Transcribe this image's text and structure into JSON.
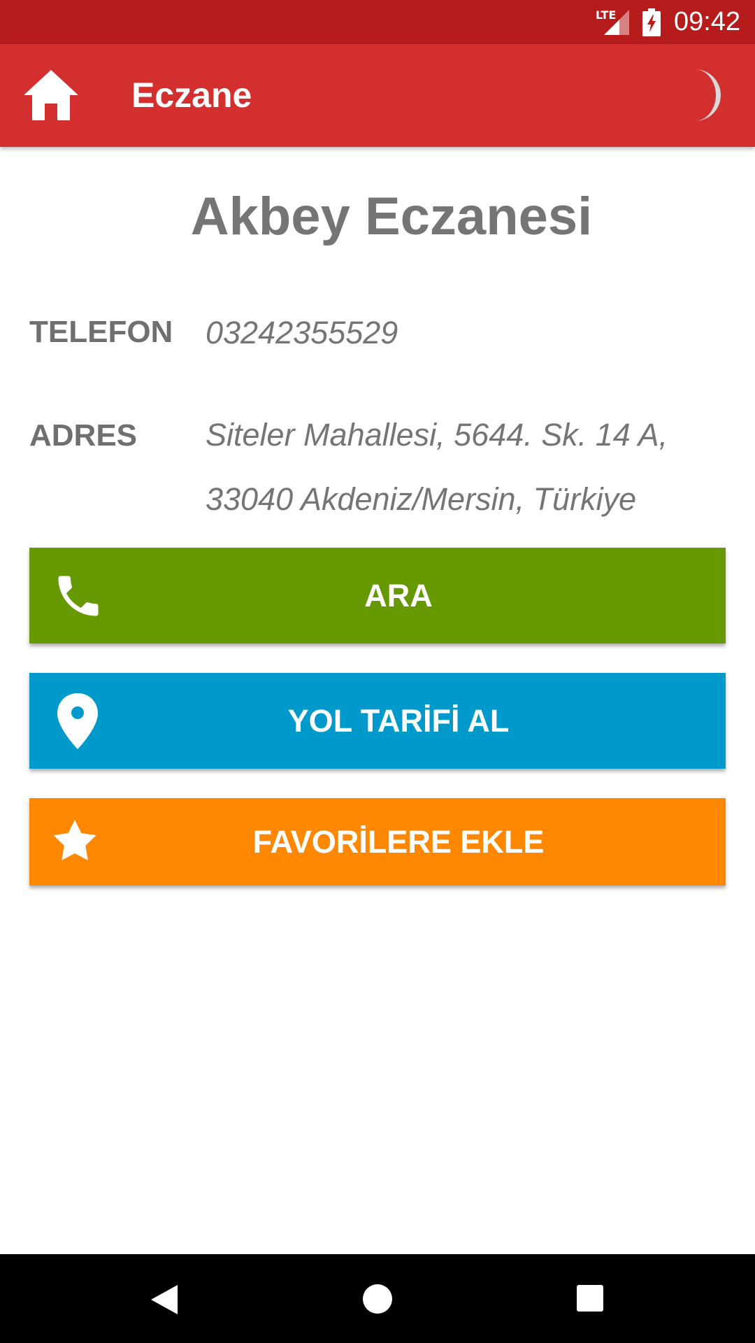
{
  "status_bar": {
    "network": "LTE",
    "time": "09:42"
  },
  "app_bar": {
    "title": "Eczane",
    "home_icon": "home-icon",
    "theme_icon": "moon-icon"
  },
  "pharmacy": {
    "name": "Akbey Eczanesi",
    "phone_label": "TELEFON",
    "phone": "03242355529",
    "address_label": "ADRES",
    "address_line1": "Siteler Mahallesi, 5644. Sk. 14 A,",
    "address_line2": "33040 Akdeniz/Mersin, Türkiye"
  },
  "actions": {
    "call_label": "ARA",
    "directions_label": "YOL TARİFİ AL",
    "favorite_label": "FAVORİLERE EKLE"
  },
  "colors": {
    "status_bar": "#B71C1C",
    "app_bar": "#D32F2F",
    "call": "#669900",
    "directions": "#0099CC",
    "favorite": "#FF8800"
  }
}
